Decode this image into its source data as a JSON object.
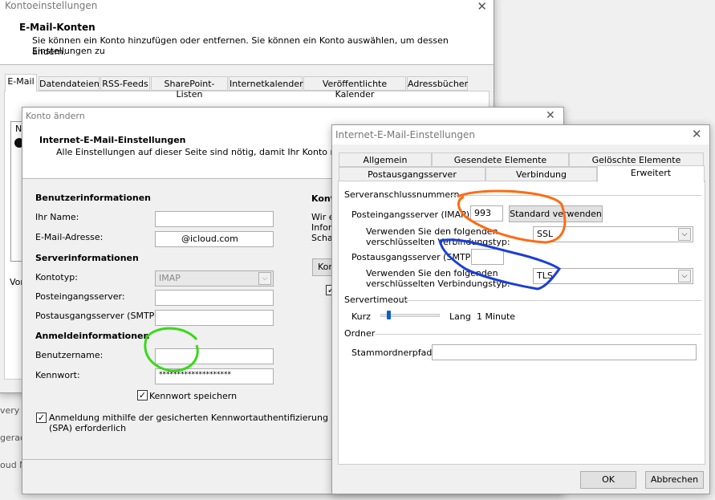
{
  "bg": {
    "lines": [
      "very R",
      "gerac",
      "oud M"
    ]
  },
  "kontoeinstellungen": {
    "title": "Kontoeinstellungen",
    "heading": "E-Mail-Konten",
    "desc1": "Sie können ein Konto hinzufügen oder entfernen. Sie können ein Konto auswählen, um dessen Einstellungen zu",
    "desc2": "ändern.",
    "tabs": [
      "E-Mail",
      "Datendateien",
      "RSS-Feeds",
      "SharePoint-Listen",
      "Internetkalender",
      "Veröffentlichte Kalender",
      "Adressbücher"
    ],
    "list_col": "N",
    "vor": "Vor"
  },
  "konto_aendern": {
    "title": "Konto ändern",
    "heading": "Internet-E-Mail-Einstellungen",
    "desc": "Alle Einstellungen auf dieser Seite sind nötig, damit Ihr Konto richtig fun",
    "user_section": "Benutzerinformationen",
    "name_label": "Ihr Name:",
    "name_value": "",
    "email_label": "E-Mail-Adresse:",
    "email_value": "@icloud.com",
    "server_section": "Serverinformationen",
    "type_label": "Kontotyp:",
    "type_value": "IMAP",
    "in_label": "Posteingangsserver:",
    "in_value": "",
    "out_label": "Postausgangsserver (SMTP):",
    "out_value": "",
    "login_section": "Anmeldeinformationen",
    "user_label": "Benutzername:",
    "user_value": "",
    "pw_label": "Kennwort:",
    "pw_value": "********************",
    "save_pw": "Kennwort speichern",
    "spa1": "Anmeldung mithilfe der gesicherten Kennwortauthentifizierung",
    "spa2": "(SPA) erforderlich",
    "right_heading": "Kont",
    "right_l1": "Wir e",
    "right_l2": "Infor",
    "right_l3": "Schal",
    "right_btn": "Kon"
  },
  "internet_settings": {
    "title": "Internet-E-Mail-Einstellungen",
    "tabs_row1": [
      "Allgemein",
      "Gesendete Elemente",
      "Gelöschte Elemente"
    ],
    "tabs_row2": [
      "Postausgangsserver",
      "Verbindung",
      "Erweitert"
    ],
    "ports_section": "Serveranschlussnummern",
    "imap_label": "Posteingangsserver (IMAP):",
    "imap_value": "993",
    "default_btn": "Standard verwenden",
    "enc_label1": "Verwenden Sie den folgenden",
    "enc_label2": "verschlüsselten Verbindungstyp:",
    "imap_enc": "SSL",
    "smtp_label": "Postausgangsserver (SMTP):",
    "smtp_value": "",
    "smtp_enc": "TLS",
    "timeout_section": "Servertimeout",
    "short": "Kurz",
    "long": "Lang",
    "timeout_value": "1 Minute",
    "timeout_fraction": 0.1,
    "folder_section": "Ordner",
    "root_label": "Stammordnerpfad:",
    "root_value": "",
    "ok": "OK",
    "cancel": "Abbrechen"
  },
  "annotation_colors": {
    "orange": "#ff6a13",
    "blue": "#1a3fd6",
    "green": "#39d81a"
  }
}
